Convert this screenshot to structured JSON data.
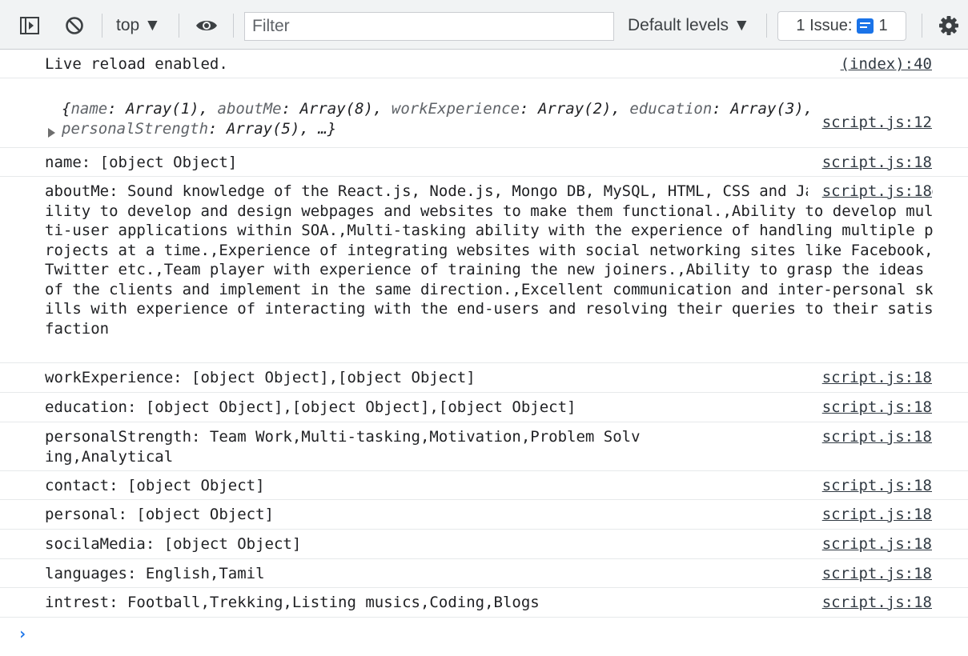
{
  "toolbar": {
    "sidebar_icon": "sidebar-toggle-icon",
    "clear_icon": "clear-console-icon",
    "context_label": "top ▼",
    "eye_icon": "eye-icon",
    "filter_placeholder": "Filter",
    "levels_label": "Default levels ▼",
    "issues_label": "1 Issue:",
    "issues_count": "1",
    "settings_icon": "gear-icon"
  },
  "colors": {
    "accent": "#1a73e8",
    "toolbar_bg": "#f1f3f4",
    "border": "#cacdd1"
  },
  "console": {
    "first": {
      "text": "Live reload enabled.",
      "source": "(index):40"
    },
    "object": {
      "source": "script.js:12",
      "parts": [
        {
          "key": "name",
          "val": "Array(1)"
        },
        {
          "key": "aboutMe",
          "val": "Array(8)"
        },
        {
          "key": "workExperience",
          "val": "Array(2)"
        },
        {
          "key": "education",
          "val": "Array(3)"
        },
        {
          "key": "personalStrength",
          "val": "Array(5)"
        }
      ],
      "open": "{",
      "close": ", …}"
    },
    "rows": [
      {
        "text": "name: [object Object]",
        "source": "script.js:18"
      },
      {
        "text": "aboutMe: Sound knowledge of the React.js, Node.js, Mongo DB, MySQL, HTML, CSS and Java Script.,Ability to develop and design webpages and websites to make them functional.,Ability to develop multi-user applications within SOA.,Multi-tasking ability with the experience of handling multiple projects at a time.,Experience of integrating websites with social networking sites like Facebook, Twitter etc.,Team player with experience of training the new joiners.,Ability to grasp the ideas of the clients and implement in the same direction.,Excellent communication and inter-personal skills with experience of interacting with the end-users and resolving their queries to their satisfaction",
        "source": "script.js:18"
      },
      {
        "text": "workExperience: [object Object],[object Object]",
        "source": "script.js:18"
      },
      {
        "text": "education: [object Object],[object Object],[object Object]",
        "source": "script.js:18"
      },
      {
        "text": "personalStrength: Team Work,Multi-tasking,Motivation,Problem Solving,Analytical",
        "source": "script.js:18"
      },
      {
        "text": "contact: [object Object]",
        "source": "script.js:18"
      },
      {
        "text": "personal: [object Object]",
        "source": "script.js:18"
      },
      {
        "text": "socilaMedia: [object Object]",
        "source": "script.js:18"
      },
      {
        "text": "languages: English,Tamil",
        "source": "script.js:18"
      },
      {
        "text": "intrest: Football,Trekking,Listing musics,Coding,Blogs",
        "source": "script.js:18"
      }
    ],
    "prompt": "›"
  }
}
